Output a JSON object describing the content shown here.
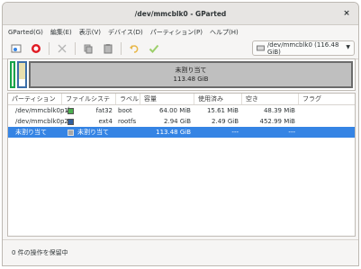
{
  "window": {
    "title": "/dev/mmcblk0 - GParted",
    "close_glyph": "×"
  },
  "menu": [
    "GParted(G)",
    "編集(E)",
    "表示(V)",
    "デバイス(D)",
    "パーティション(P)",
    "ヘルプ(H)"
  ],
  "device_selector": {
    "label": "/dev/mmcblk0 (116.48 GiB)"
  },
  "diskmap": {
    "unallocated_label": "未割り当て",
    "unallocated_size": "113.48 GiB"
  },
  "table": {
    "headers": [
      "パーティション",
      "ファイルシステム",
      "ラベル",
      "容量",
      "使用済み",
      "空き",
      "フラグ"
    ],
    "rows": [
      {
        "partition": "/dev/mmcblk0p1",
        "fs": "fat32",
        "fs_color": "#4caf50",
        "label": "boot",
        "size": "64.00 MiB",
        "used": "15.61 MiB",
        "free": "48.39 MiB",
        "flags": ""
      },
      {
        "partition": "/dev/mmcblk0p2",
        "fs": "ext4",
        "fs_color": "#2f5e9e",
        "label": "rootfs",
        "size": "2.94 GiB",
        "used": "2.49 GiB",
        "free": "452.99 MiB",
        "flags": ""
      },
      {
        "partition": "未割り当て",
        "fs": "未割り当て",
        "fs_color": "#a8a8a8",
        "label": "",
        "size": "113.48 GiB",
        "used": "---",
        "free": "---",
        "flags": ""
      }
    ]
  },
  "status": {
    "text": "0 件の操作を保留中"
  }
}
